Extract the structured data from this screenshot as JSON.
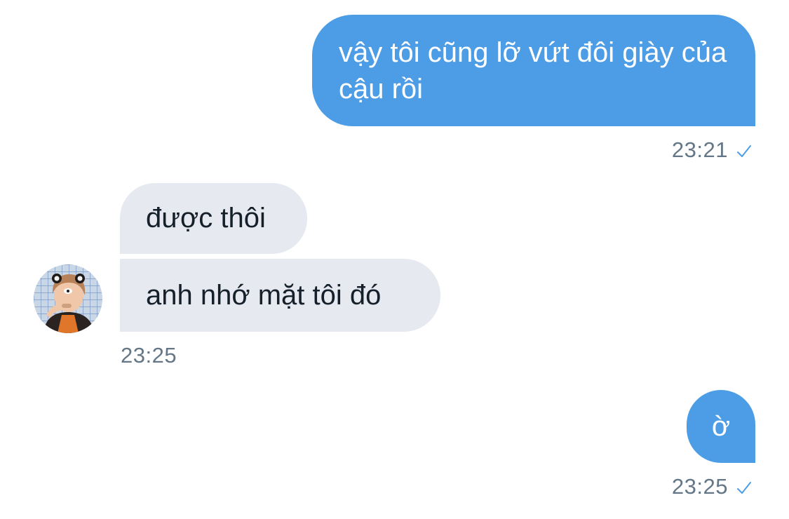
{
  "messages": [
    {
      "direction": "outgoing",
      "text": "vậy tôi cũng lỡ vứt đôi giày của cậu rồi"
    },
    {
      "direction": "incoming",
      "text": "được thôi"
    },
    {
      "direction": "incoming",
      "text": "anh nhớ mặt tôi đó"
    },
    {
      "direction": "outgoing",
      "text": "ờ"
    }
  ],
  "timestamps": {
    "first_outgoing": "23:21",
    "incoming_group": "23:25",
    "second_outgoing": "23:25"
  },
  "icons": {
    "read_receipt": "checkmark-icon",
    "avatar": "profile-avatar"
  },
  "colors": {
    "outgoing_bubble": "#4d9de6",
    "incoming_bubble": "#e6e9ef",
    "timestamp_text": "#657786",
    "checkmark": "#4d9de6"
  }
}
